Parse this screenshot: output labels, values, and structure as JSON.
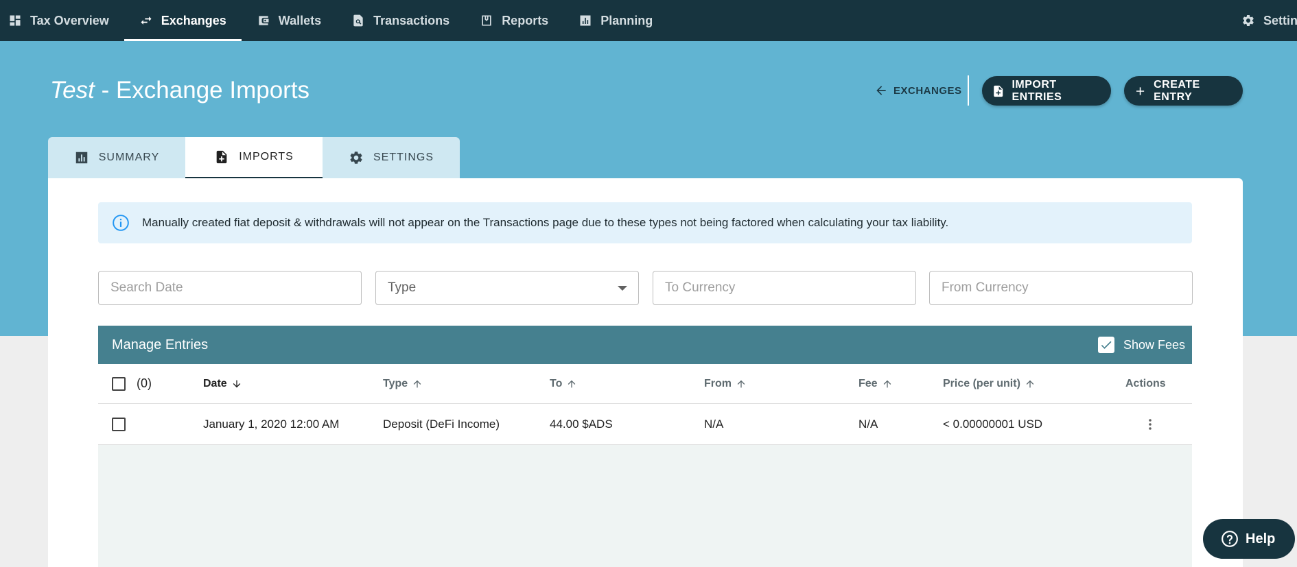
{
  "nav": {
    "items": [
      {
        "label": "Tax Overview",
        "icon": "dashboard-icon"
      },
      {
        "label": "Exchanges",
        "icon": "swap-icon",
        "active": true
      },
      {
        "label": "Wallets",
        "icon": "wallet-icon"
      },
      {
        "label": "Transactions",
        "icon": "transaction-search-icon"
      },
      {
        "label": "Reports",
        "icon": "report-download-icon"
      },
      {
        "label": "Planning",
        "icon": "bar-chart-icon"
      }
    ],
    "settings_label": "Settings"
  },
  "header": {
    "title_italic": "Test",
    "title_rest": " - Exchange Imports",
    "back_label": "EXCHANGES",
    "import_label": "IMPORT ENTRIES",
    "create_label": "CREATE ENTRY"
  },
  "tabs": [
    {
      "label": "SUMMARY",
      "icon": "bar-chart-icon"
    },
    {
      "label": "IMPORTS",
      "icon": "file-add-icon",
      "active": true
    },
    {
      "label": "SETTINGS",
      "icon": "gear-icon"
    }
  ],
  "info_banner": {
    "text": "Manually created fiat deposit & withdrawals will not appear on the Transactions page due to these types not being factored when calculating your tax liability."
  },
  "filters": {
    "search_date_placeholder": "Search Date",
    "type_label": "Type",
    "to_currency_placeholder": "To Currency",
    "from_currency_placeholder": "From Currency"
  },
  "table": {
    "title": "Manage Entries",
    "show_fees_label": "Show Fees",
    "show_fees_checked": true,
    "selected_count": "(0)",
    "columns": {
      "date": "Date",
      "type": "Type",
      "to": "To",
      "from": "From",
      "fee": "Fee",
      "price": "Price (per unit)",
      "actions": "Actions"
    },
    "rows": [
      {
        "date": "January 1, 2020 12:00 AM",
        "type": "Deposit (DeFi Income)",
        "to": "44.00 $ADS",
        "from": "N/A",
        "fee": "N/A",
        "price": "< 0.00000001 USD"
      }
    ]
  },
  "help_label": "Help",
  "colors": {
    "nav_bg": "#17343f",
    "hero_bg": "#61b4d2",
    "table_header_bg": "#45808f",
    "tab_inactive_bg": "#cfe8f2",
    "info_bg": "#e3f2fb",
    "info_icon": "#2196f3"
  }
}
